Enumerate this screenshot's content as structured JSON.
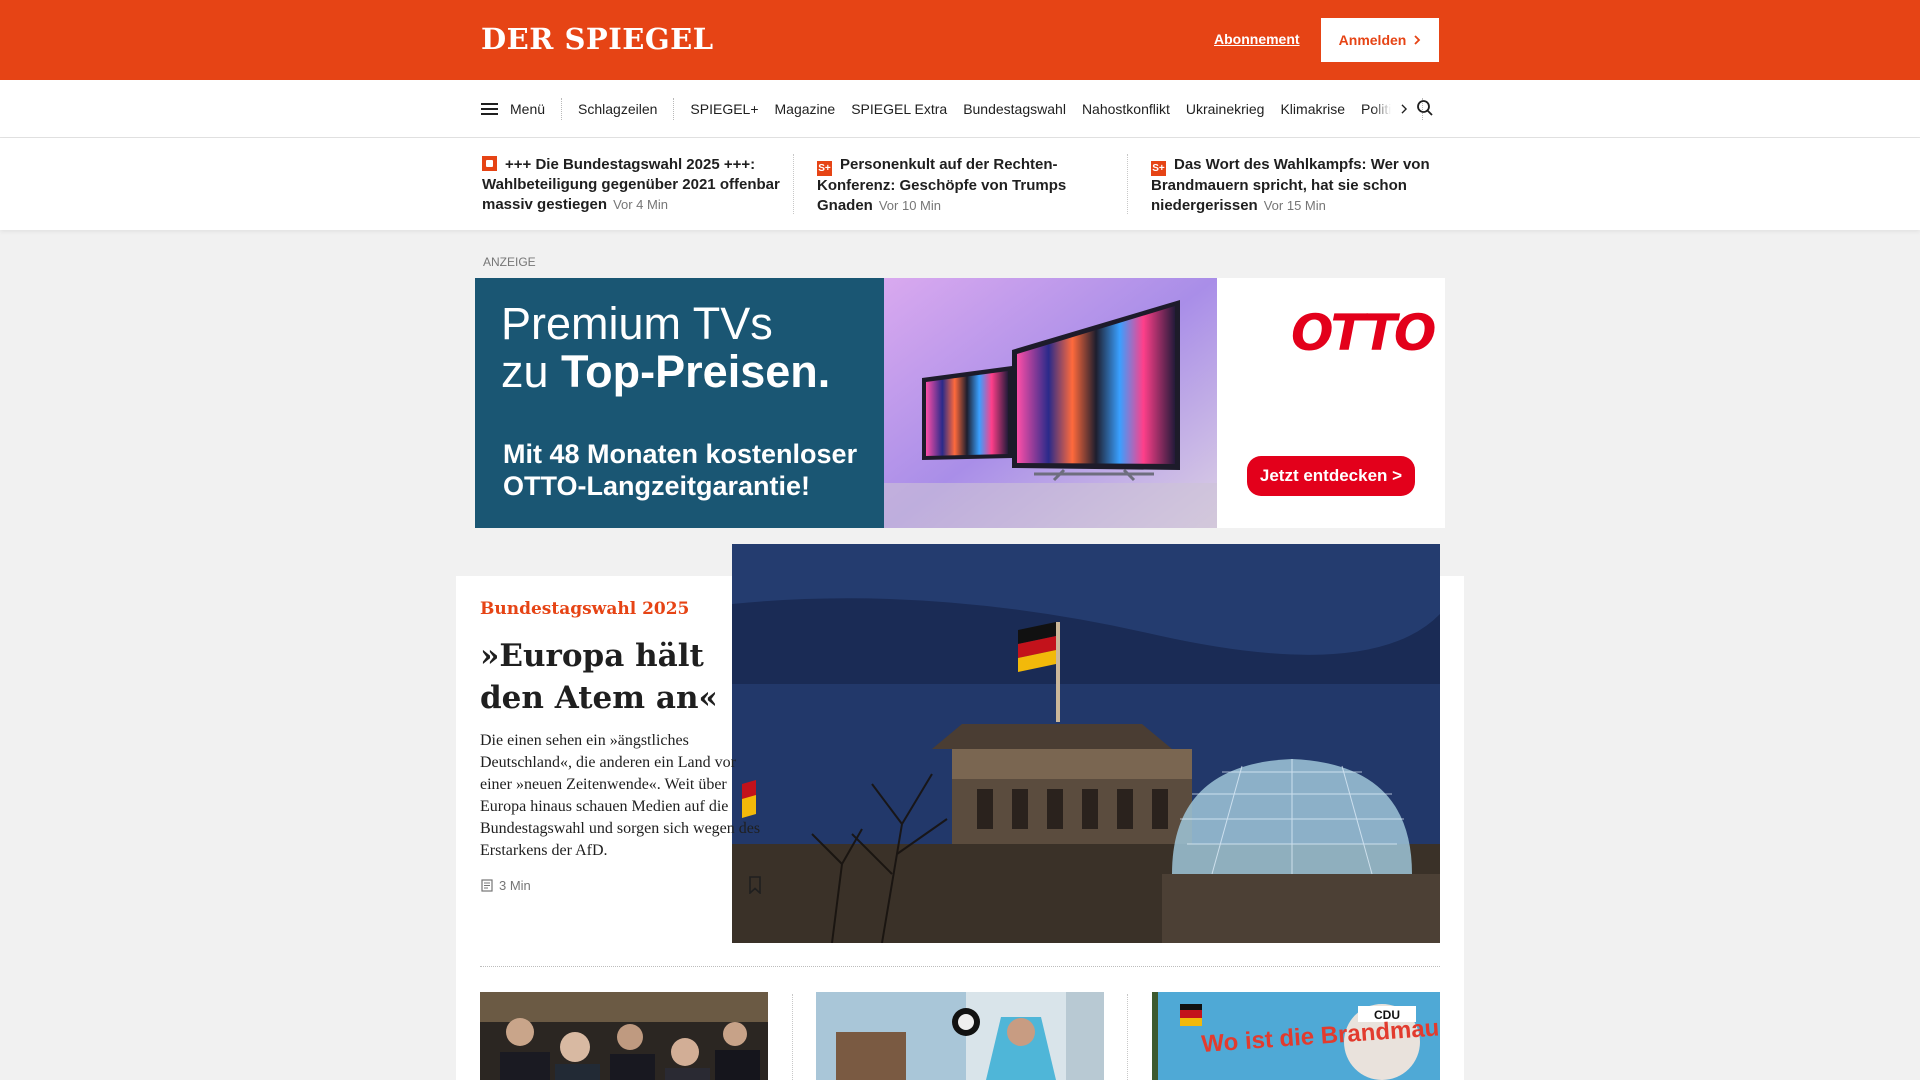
{
  "header": {
    "logo": "DER SPIEGEL",
    "subscription_link": "Abonnement",
    "login_button": "Anmelden"
  },
  "nav": {
    "menu_label": "Menü",
    "items": [
      "Schlagzeilen",
      "SPIEGEL+",
      "Magazine",
      "SPIEGEL Extra",
      "Bundestagswahl",
      "Nahostkonflikt",
      "Ukrainekrieg",
      "Klimakrise"
    ],
    "overflow_item": "Politik"
  },
  "ticker": [
    {
      "badge": "live",
      "title": "+++ Die Bundestagswahl 2025 +++: Wahlbeteiligung gegenüber 2021 offenbar massiv gestiegen",
      "time": "Vor 4 Min"
    },
    {
      "badge": "S+",
      "title": "Personenkult auf der Rechten-Konferenz: Geschöpfe von Trumps Gnaden",
      "time": "Vor 10 Min"
    },
    {
      "badge": "S+",
      "title": "Das Wort des Wahlkampfs: Wer von Brandmauern spricht, hat sie schon niedergerissen",
      "time": "Vor 15 Min"
    }
  ],
  "ad": {
    "label": "ANZEIGE",
    "headline_light_1": "Premium TVs",
    "headline_light_2": "zu ",
    "headline_bold": "Top-Preisen.",
    "subline": "Mit 48 Monaten kostenloser OTTO-Langzeitgarantie!",
    "brand": "OTTO",
    "cta": "Jetzt entdecken >"
  },
  "lead_article": {
    "kicker": "Bundestagswahl 2025",
    "headline": "»Europa hält den Atem an«",
    "teaser": "Die einen sehen ein »ängstliches Deutschland«, die anderen ein Land vor einer »neuen Zeitenwende«. Weit über Europa hinaus schauen Medien auf die Bundestagswahl und sorgen sich wegen des Erstarkens der AfD.",
    "read_time": "3 Min"
  },
  "thumbs": [
    {
      "label": "",
      "poster_text": ""
    },
    {
      "label": "",
      "poster_text": ""
    },
    {
      "label": "",
      "poster_text": "Wo ist die Brandmauer",
      "poster_brand": "CDU"
    }
  ],
  "colors": {
    "brand": "#e64415",
    "ad_blue": "#1a5673",
    "otto_red": "#e3001b"
  }
}
